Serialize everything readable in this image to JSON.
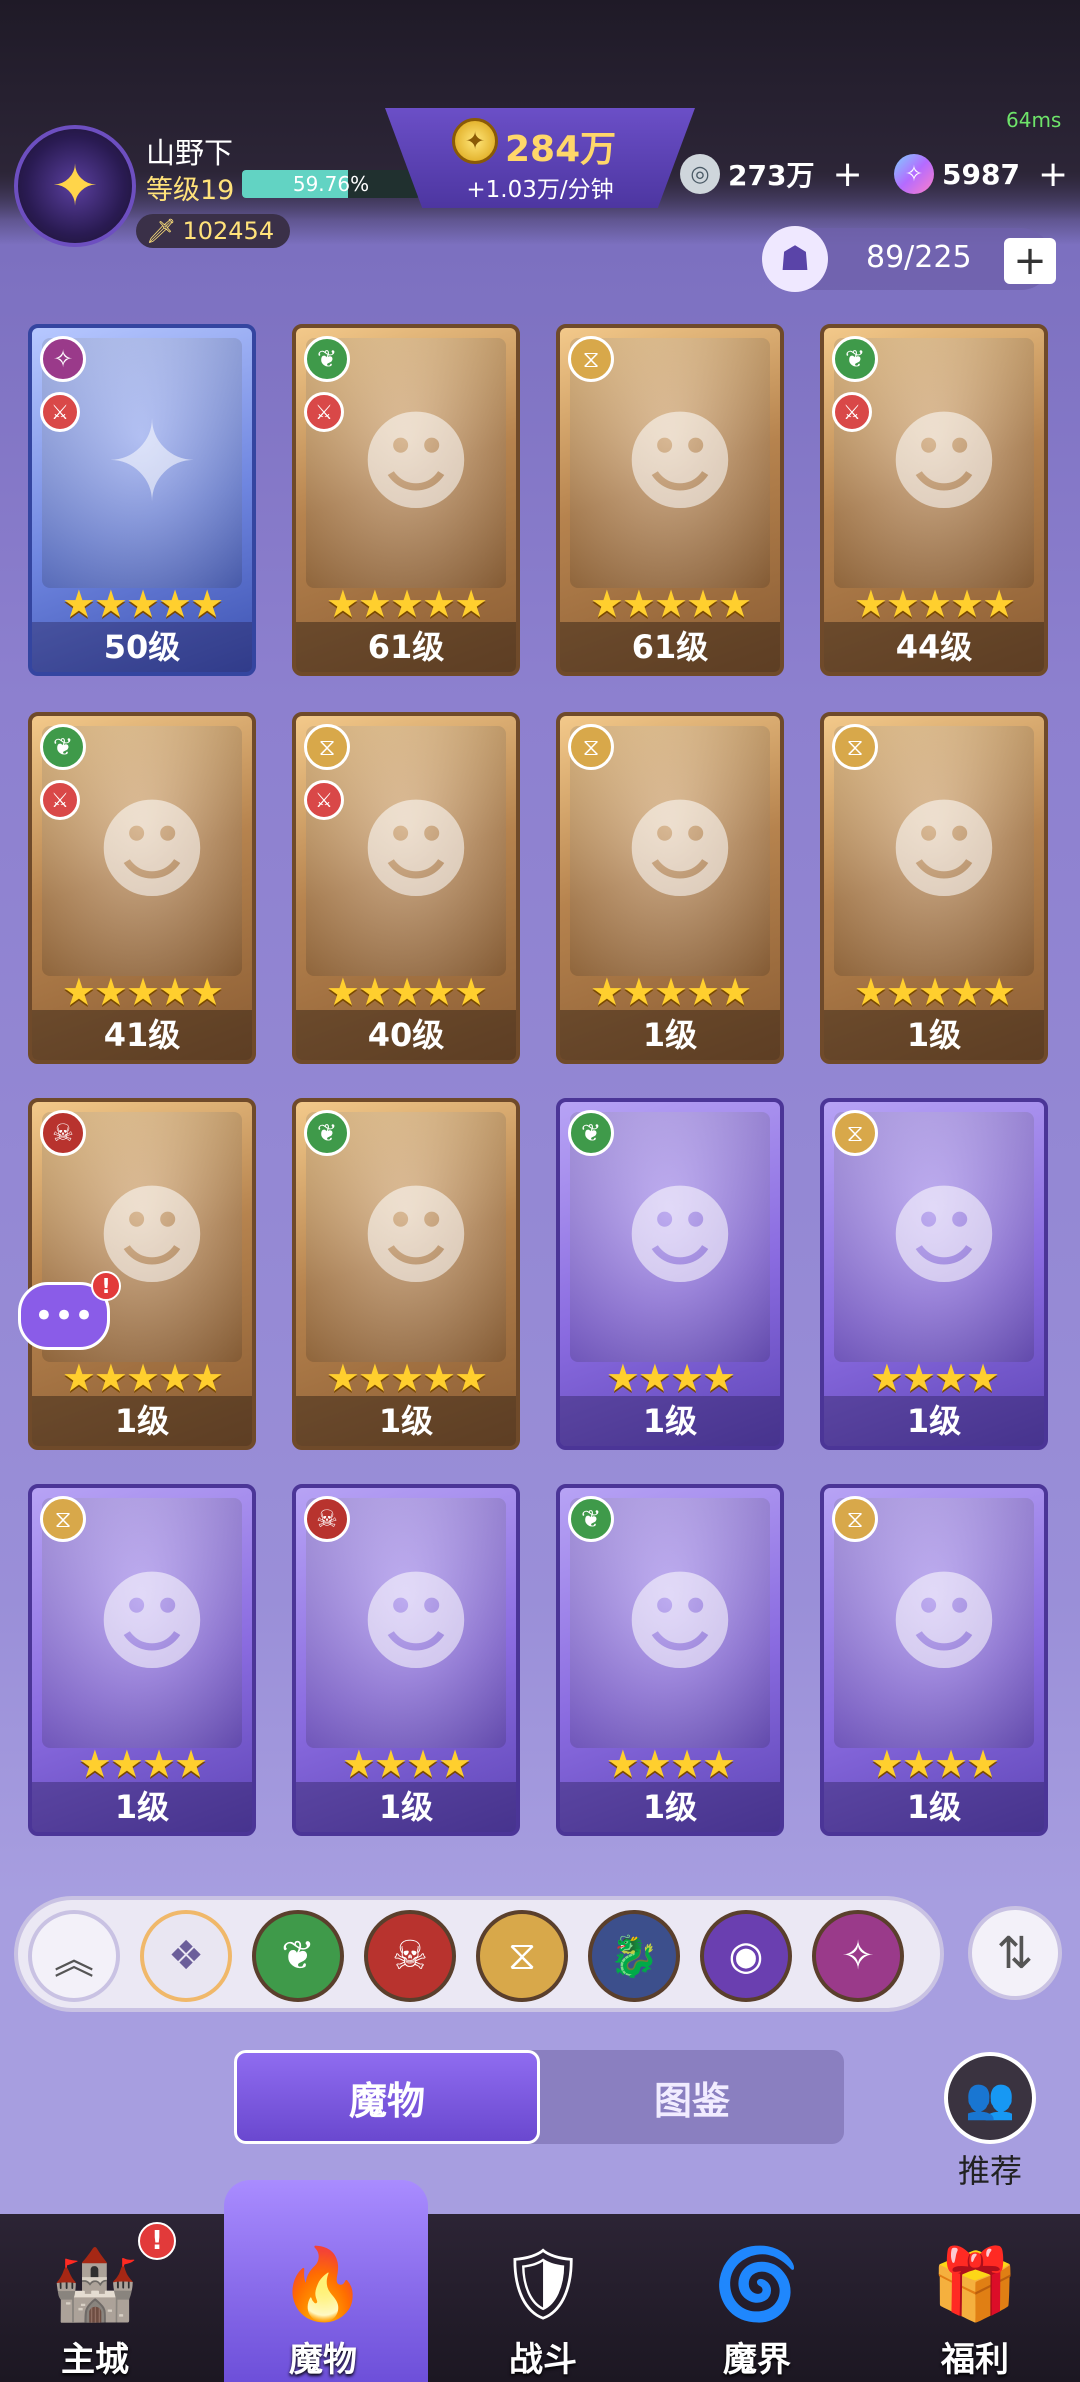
{
  "header": {
    "ping": "64ms",
    "player_name": "山野下",
    "level_label": "等级19",
    "xp_percent_text": "59.76%",
    "xp_fraction": 0.5976,
    "power": "102454",
    "gold": "284万",
    "gold_rate": "+1.03万/分钟",
    "currency_silver": "273万",
    "currency_gem": "5987",
    "plus": "+",
    "roster_count": "89/225"
  },
  "cards": [
    {
      "faction": "mystic",
      "role": true,
      "stars": "★★★★★",
      "level": "50级",
      "frame": "blue",
      "art": "egg-icon"
    },
    {
      "faction": "nature",
      "role": true,
      "stars": "★★★★★",
      "level": "61级",
      "frame": "gold",
      "art": "hero-portrait"
    },
    {
      "faction": "order",
      "role": false,
      "stars": "★★★★★",
      "level": "61级",
      "frame": "gold",
      "art": "hero-portrait"
    },
    {
      "faction": "nature",
      "role": true,
      "stars": "★★★★★",
      "level": "44级",
      "frame": "gold",
      "art": "hero-portrait"
    },
    {
      "faction": "nature",
      "role": true,
      "stars": "★★★★★",
      "level": "41级",
      "frame": "gold",
      "art": "hero-portrait"
    },
    {
      "faction": "order",
      "role": true,
      "stars": "★★★★★",
      "level": "40级",
      "frame": "gold",
      "art": "hero-portrait"
    },
    {
      "faction": "order",
      "role": false,
      "stars": "★★★★★",
      "level": "1级",
      "frame": "gold",
      "art": "hero-portrait"
    },
    {
      "faction": "order",
      "role": false,
      "stars": "★★★★★",
      "level": "1级",
      "frame": "gold",
      "art": "hero-portrait"
    },
    {
      "faction": "chaos",
      "role": false,
      "stars": "★★★★★",
      "level": "1级",
      "frame": "gold",
      "art": "hero-portrait"
    },
    {
      "faction": "nature",
      "role": false,
      "stars": "★★★★★",
      "level": "1级",
      "frame": "gold",
      "art": "hero-portrait"
    },
    {
      "faction": "nature",
      "role": false,
      "stars": "★★★★",
      "level": "1级",
      "frame": "purple",
      "art": "hero-portrait"
    },
    {
      "faction": "order",
      "role": false,
      "stars": "★★★★",
      "level": "1级",
      "frame": "purple",
      "art": "hero-portrait"
    },
    {
      "faction": "order",
      "role": false,
      "stars": "★★★★",
      "level": "1级",
      "frame": "purple",
      "art": "hero-portrait"
    },
    {
      "faction": "chaos",
      "role": false,
      "stars": "★★★★",
      "level": "1级",
      "frame": "purple",
      "art": "hero-portrait"
    },
    {
      "faction": "nature",
      "role": false,
      "stars": "★★★★",
      "level": "1级",
      "frame": "purple",
      "art": "hero-portrait"
    },
    {
      "faction": "order",
      "role": false,
      "stars": "★★★★",
      "level": "1级",
      "frame": "purple",
      "art": "hero-portrait"
    }
  ],
  "filters": [
    "collapse-icon",
    "all-factions-icon",
    "nature-icon",
    "chaos-icon",
    "order-icon",
    "dragon-icon",
    "eye-icon",
    "mystic-icon"
  ],
  "tabs": {
    "active": "魔物",
    "inactive": "图鉴"
  },
  "recommend_label": "推荐",
  "nav": [
    {
      "label": "主城",
      "icon": "castle-icon"
    },
    {
      "label": "魔物",
      "icon": "flame-icon"
    },
    {
      "label": "战斗",
      "icon": "sword-shield-icon"
    },
    {
      "label": "魔界",
      "icon": "portal-icon"
    },
    {
      "label": "福利",
      "icon": "chest-icon"
    }
  ],
  "colors": {
    "nature": "#3f9a4a",
    "chaos": "#b8332e",
    "order": "#d8a84a",
    "mystic": "#9a3a8a",
    "dragon": "#3c4f8c",
    "eye": "#6a3fb0",
    "all": "#e9e6f2"
  }
}
